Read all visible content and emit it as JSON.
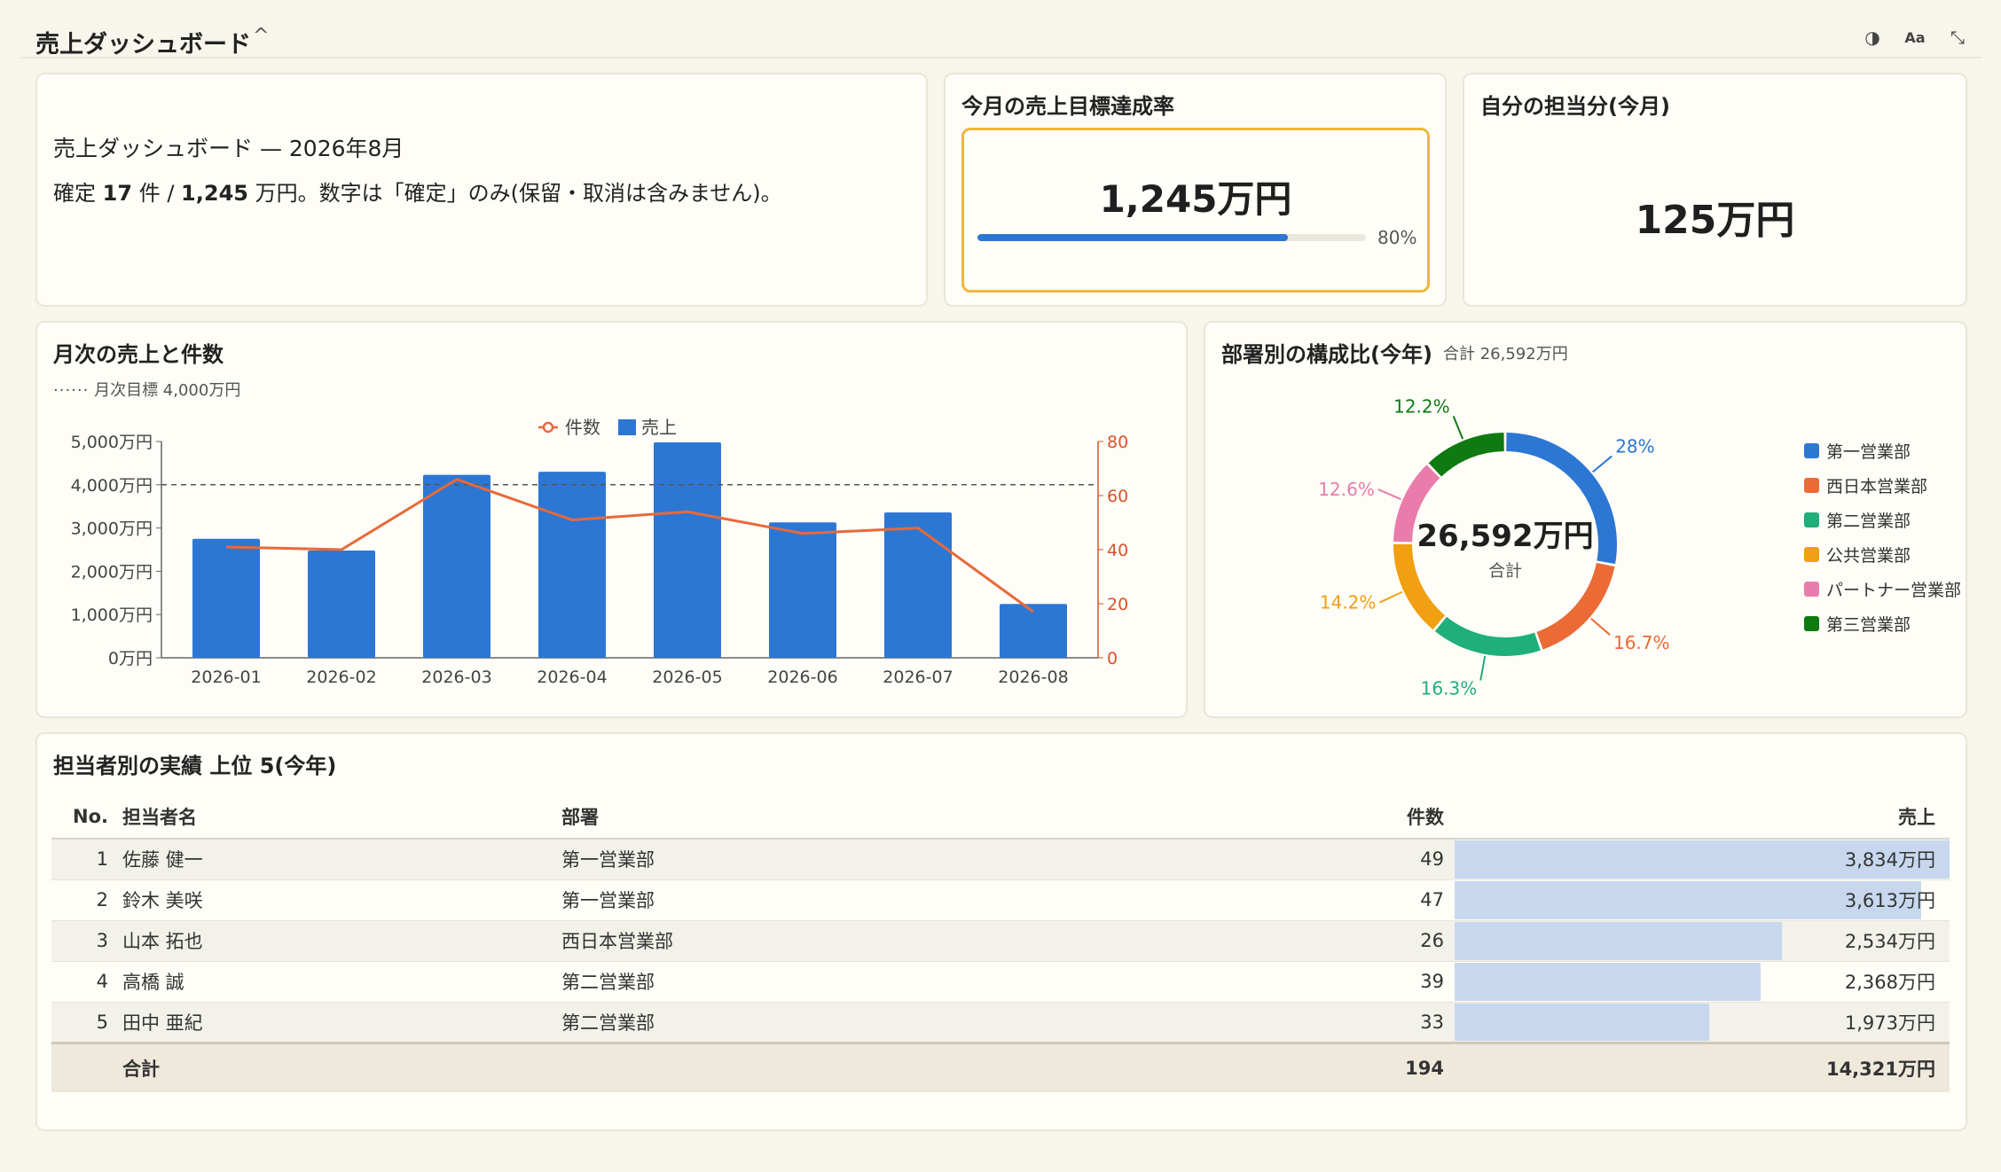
{
  "header": {
    "title": "売上ダッシュボード",
    "chevron": "^",
    "icons": [
      "contrast-icon",
      "font-size-icon",
      "collapse-icon"
    ]
  },
  "summary": {
    "heading": "売上ダッシュボード — 2026年8月",
    "prefix": "確定",
    "count": "17",
    "count_unit": "件 /",
    "amount": "1,245",
    "suffix": "万円。数字は「確定」のみ(保留・取消は含みません)。"
  },
  "goal": {
    "title": "今月の売上目標達成率",
    "value": "1,245万円",
    "progress": 0.8,
    "progress_label": "80%",
    "bar_color": "#2c77d4"
  },
  "own": {
    "title": "自分の担当分(今月)",
    "value": "125万円"
  },
  "monthly": {
    "title": "月次の売上と件数",
    "target_note": "月次目標 4,000万円",
    "legend_count": "件数",
    "legend_sales": "売上"
  },
  "chart_data": [
    {
      "type": "bar",
      "title": "月次の売上と件数",
      "categories": [
        "2026-01",
        "2026-02",
        "2026-03",
        "2026-04",
        "2026-05",
        "2026-06",
        "2026-07",
        "2026-08"
      ],
      "series": [
        {
          "name": "売上",
          "type": "bar",
          "axis": "left",
          "values": [
            2750,
            2480,
            4230,
            4300,
            4980,
            3130,
            3360,
            1245
          ],
          "color": "#2c77d4"
        },
        {
          "name": "件数",
          "type": "line",
          "axis": "right",
          "values": [
            41,
            40,
            66,
            51,
            54,
            46,
            48,
            17
          ],
          "color": "#e8693a"
        }
      ],
      "y_left": {
        "ticks": [
          "0万円",
          "1,000万円",
          "2,000万円",
          "3,000万円",
          "4,000万円",
          "5,000万円"
        ],
        "ylim": [
          0,
          5000
        ]
      },
      "y_right": {
        "ticks": [
          "0",
          "20",
          "40",
          "60",
          "80"
        ],
        "ylim": [
          0,
          80
        ]
      },
      "target_line": 4000,
      "legend_position": "top-center"
    },
    {
      "type": "pie",
      "title": "部署別の構成比(今年)",
      "total_label": "合計 26,592万円",
      "center_value": "26,592万円",
      "center_label": "合計",
      "labels": [
        "第一営業部",
        "西日本営業部",
        "第二営業部",
        "公共営業部",
        "パートナー営業部",
        "第三営業部"
      ],
      "values": [
        28,
        16.7,
        16.3,
        14.2,
        12.6,
        12.2
      ],
      "value_labels": [
        "28%",
        "16.7%",
        "16.3%",
        "14.2%",
        "12.6%",
        "12.2%"
      ],
      "colors": [
        "#2c77d4",
        "#eb6a35",
        "#1faf7a",
        "#f0a010",
        "#e97caa",
        "#0f7a12"
      ],
      "legend_position": "right"
    }
  ],
  "ranking": {
    "title": "担当者別の実績 上位 5(今年)",
    "columns": {
      "no": "No.",
      "name": "担当者名",
      "dept": "部署",
      "count": "件数",
      "sales": "売上"
    },
    "rows": [
      {
        "no": "1",
        "name": "佐藤 健一",
        "dept": "第一営業部",
        "count": "49",
        "sales": "3,834万円",
        "ratio": 1.0
      },
      {
        "no": "2",
        "name": "鈴木 美咲",
        "dept": "第一営業部",
        "count": "47",
        "sales": "3,613万円",
        "ratio": 0.942
      },
      {
        "no": "3",
        "name": "山本 拓也",
        "dept": "西日本営業部",
        "count": "26",
        "sales": "2,534万円",
        "ratio": 0.661
      },
      {
        "no": "4",
        "name": "高橋 誠",
        "dept": "第二営業部",
        "count": "39",
        "sales": "2,368万円",
        "ratio": 0.618
      },
      {
        "no": "5",
        "name": "田中 亜紀",
        "dept": "第二営業部",
        "count": "33",
        "sales": "1,973万円",
        "ratio": 0.515
      }
    ],
    "total": {
      "label": "合計",
      "count": "194",
      "sales": "14,321万円"
    }
  }
}
